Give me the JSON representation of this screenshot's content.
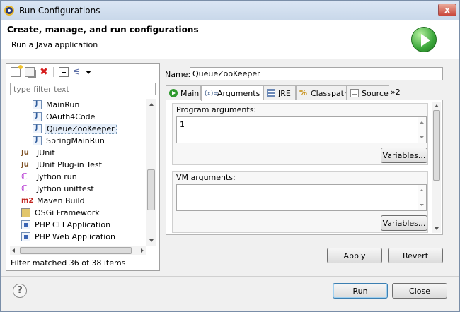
{
  "window": {
    "title": "Run Configurations",
    "close_glyph": "x"
  },
  "header": {
    "title": "Create, manage, and run configurations",
    "subtitle": "Run a Java application",
    "icon": "run-icon"
  },
  "left": {
    "filter_placeholder": "type filter text",
    "tree": [
      {
        "label": "MainRun",
        "icon": "java-app-icon",
        "indent": 2
      },
      {
        "label": "OAuth4Code",
        "icon": "java-app-icon",
        "indent": 2
      },
      {
        "label": "QueueZooKeeper",
        "icon": "java-app-icon",
        "indent": 2,
        "selected": true
      },
      {
        "label": "SpringMainRun",
        "icon": "java-app-icon",
        "indent": 2
      },
      {
        "label": "JUnit",
        "icon": "junit-icon",
        "indent": 1
      },
      {
        "label": "JUnit Plug-in Test",
        "icon": "junit-plugin-icon",
        "indent": 1
      },
      {
        "label": "Jython run",
        "icon": "jython-icon",
        "indent": 1
      },
      {
        "label": "Jython unittest",
        "icon": "jython-unittest-icon",
        "indent": 1
      },
      {
        "label": "Maven Build",
        "icon": "maven-icon",
        "indent": 1
      },
      {
        "label": "OSGi Framework",
        "icon": "osgi-icon",
        "indent": 1
      },
      {
        "label": "PHP CLI Application",
        "icon": "php-icon",
        "indent": 1
      },
      {
        "label": "PHP Web Application",
        "icon": "php-web-icon",
        "indent": 1
      }
    ],
    "icon_glyphs": {
      "junit": "Ju",
      "jython": "ℂ",
      "maven": "m2",
      "classpath": "%"
    },
    "status": "Filter matched 36 of 38 items"
  },
  "right": {
    "name_label": "Name:",
    "name_value": "QueueZooKeeper",
    "tabs": [
      {
        "label": "Main",
        "icon": "main-tab-icon"
      },
      {
        "label": "Arguments",
        "icon": "arguments-icon",
        "active": true
      },
      {
        "label": "JRE",
        "icon": "jre-icon"
      },
      {
        "label": "Classpath",
        "icon": "classpath-icon"
      },
      {
        "label": "Source",
        "icon": "source-icon"
      }
    ],
    "tabs_overflow": "»2",
    "args_icon_text": "(x)=",
    "program_args": {
      "label": "Program arguments:",
      "value": "1",
      "variables_label": "Variables..."
    },
    "vm_args": {
      "label": "VM arguments:",
      "value": "",
      "variables_label": "Variables..."
    },
    "apply_label": "Apply",
    "revert_label": "Revert"
  },
  "footer": {
    "help_glyph": "?",
    "run_label": "Run",
    "close_label": "Close"
  }
}
